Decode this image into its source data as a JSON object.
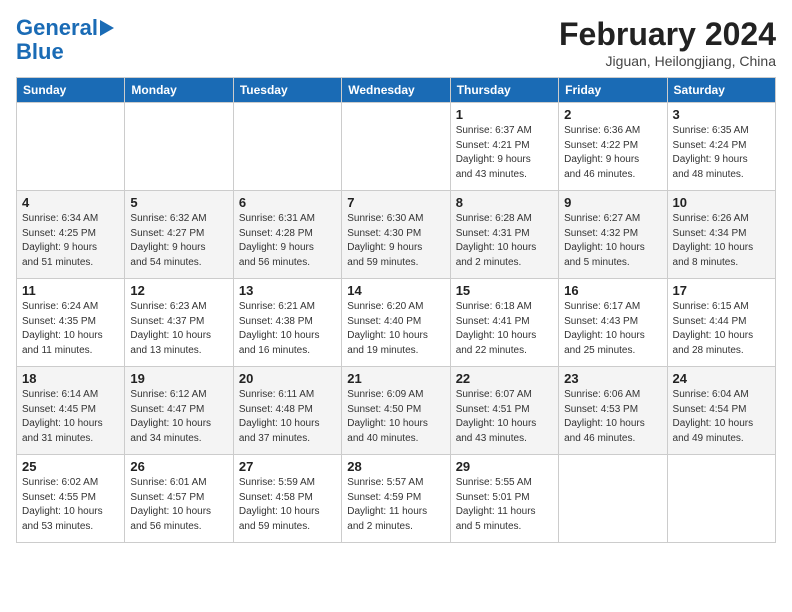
{
  "header": {
    "logo_line1": "General",
    "logo_line2": "Blue",
    "month_title": "February 2024",
    "location": "Jiguan, Heilongjiang, China"
  },
  "weekdays": [
    "Sunday",
    "Monday",
    "Tuesday",
    "Wednesday",
    "Thursday",
    "Friday",
    "Saturday"
  ],
  "weeks": [
    [
      {
        "day": "",
        "info": ""
      },
      {
        "day": "",
        "info": ""
      },
      {
        "day": "",
        "info": ""
      },
      {
        "day": "",
        "info": ""
      },
      {
        "day": "1",
        "info": "Sunrise: 6:37 AM\nSunset: 4:21 PM\nDaylight: 9 hours\nand 43 minutes."
      },
      {
        "day": "2",
        "info": "Sunrise: 6:36 AM\nSunset: 4:22 PM\nDaylight: 9 hours\nand 46 minutes."
      },
      {
        "day": "3",
        "info": "Sunrise: 6:35 AM\nSunset: 4:24 PM\nDaylight: 9 hours\nand 48 minutes."
      }
    ],
    [
      {
        "day": "4",
        "info": "Sunrise: 6:34 AM\nSunset: 4:25 PM\nDaylight: 9 hours\nand 51 minutes."
      },
      {
        "day": "5",
        "info": "Sunrise: 6:32 AM\nSunset: 4:27 PM\nDaylight: 9 hours\nand 54 minutes."
      },
      {
        "day": "6",
        "info": "Sunrise: 6:31 AM\nSunset: 4:28 PM\nDaylight: 9 hours\nand 56 minutes."
      },
      {
        "day": "7",
        "info": "Sunrise: 6:30 AM\nSunset: 4:30 PM\nDaylight: 9 hours\nand 59 minutes."
      },
      {
        "day": "8",
        "info": "Sunrise: 6:28 AM\nSunset: 4:31 PM\nDaylight: 10 hours\nand 2 minutes."
      },
      {
        "day": "9",
        "info": "Sunrise: 6:27 AM\nSunset: 4:32 PM\nDaylight: 10 hours\nand 5 minutes."
      },
      {
        "day": "10",
        "info": "Sunrise: 6:26 AM\nSunset: 4:34 PM\nDaylight: 10 hours\nand 8 minutes."
      }
    ],
    [
      {
        "day": "11",
        "info": "Sunrise: 6:24 AM\nSunset: 4:35 PM\nDaylight: 10 hours\nand 11 minutes."
      },
      {
        "day": "12",
        "info": "Sunrise: 6:23 AM\nSunset: 4:37 PM\nDaylight: 10 hours\nand 13 minutes."
      },
      {
        "day": "13",
        "info": "Sunrise: 6:21 AM\nSunset: 4:38 PM\nDaylight: 10 hours\nand 16 minutes."
      },
      {
        "day": "14",
        "info": "Sunrise: 6:20 AM\nSunset: 4:40 PM\nDaylight: 10 hours\nand 19 minutes."
      },
      {
        "day": "15",
        "info": "Sunrise: 6:18 AM\nSunset: 4:41 PM\nDaylight: 10 hours\nand 22 minutes."
      },
      {
        "day": "16",
        "info": "Sunrise: 6:17 AM\nSunset: 4:43 PM\nDaylight: 10 hours\nand 25 minutes."
      },
      {
        "day": "17",
        "info": "Sunrise: 6:15 AM\nSunset: 4:44 PM\nDaylight: 10 hours\nand 28 minutes."
      }
    ],
    [
      {
        "day": "18",
        "info": "Sunrise: 6:14 AM\nSunset: 4:45 PM\nDaylight: 10 hours\nand 31 minutes."
      },
      {
        "day": "19",
        "info": "Sunrise: 6:12 AM\nSunset: 4:47 PM\nDaylight: 10 hours\nand 34 minutes."
      },
      {
        "day": "20",
        "info": "Sunrise: 6:11 AM\nSunset: 4:48 PM\nDaylight: 10 hours\nand 37 minutes."
      },
      {
        "day": "21",
        "info": "Sunrise: 6:09 AM\nSunset: 4:50 PM\nDaylight: 10 hours\nand 40 minutes."
      },
      {
        "day": "22",
        "info": "Sunrise: 6:07 AM\nSunset: 4:51 PM\nDaylight: 10 hours\nand 43 minutes."
      },
      {
        "day": "23",
        "info": "Sunrise: 6:06 AM\nSunset: 4:53 PM\nDaylight: 10 hours\nand 46 minutes."
      },
      {
        "day": "24",
        "info": "Sunrise: 6:04 AM\nSunset: 4:54 PM\nDaylight: 10 hours\nand 49 minutes."
      }
    ],
    [
      {
        "day": "25",
        "info": "Sunrise: 6:02 AM\nSunset: 4:55 PM\nDaylight: 10 hours\nand 53 minutes."
      },
      {
        "day": "26",
        "info": "Sunrise: 6:01 AM\nSunset: 4:57 PM\nDaylight: 10 hours\nand 56 minutes."
      },
      {
        "day": "27",
        "info": "Sunrise: 5:59 AM\nSunset: 4:58 PM\nDaylight: 10 hours\nand 59 minutes."
      },
      {
        "day": "28",
        "info": "Sunrise: 5:57 AM\nSunset: 4:59 PM\nDaylight: 11 hours\nand 2 minutes."
      },
      {
        "day": "29",
        "info": "Sunrise: 5:55 AM\nSunset: 5:01 PM\nDaylight: 11 hours\nand 5 minutes."
      },
      {
        "day": "",
        "info": ""
      },
      {
        "day": "",
        "info": ""
      }
    ]
  ]
}
